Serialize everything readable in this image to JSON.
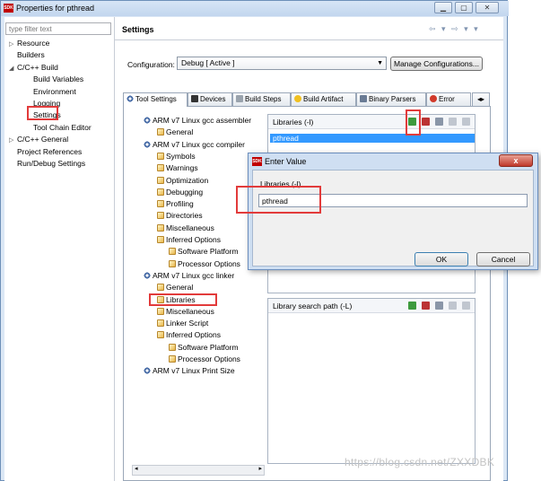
{
  "window": {
    "title": "Properties for pthread",
    "app_icon": "SDK",
    "controls": [
      "minimize-icon",
      "maximize-icon",
      "close-icon"
    ]
  },
  "filter": {
    "placeholder": "type filter text"
  },
  "nav_tree": [
    {
      "label": "Resource",
      "indent": 0,
      "toggle": "▷"
    },
    {
      "label": "Builders",
      "indent": 0,
      "toggle": ""
    },
    {
      "label": "C/C++ Build",
      "indent": 0,
      "toggle": "◢"
    },
    {
      "label": "Build Variables",
      "indent": 1,
      "toggle": ""
    },
    {
      "label": "Environment",
      "indent": 1,
      "toggle": ""
    },
    {
      "label": "Logging",
      "indent": 1,
      "toggle": ""
    },
    {
      "label": "Settings",
      "indent": 1,
      "toggle": ""
    },
    {
      "label": "Tool Chain Editor",
      "indent": 1,
      "toggle": ""
    },
    {
      "label": "C/C++ General",
      "indent": 0,
      "toggle": "▷"
    },
    {
      "label": "Project References",
      "indent": 0,
      "toggle": ""
    },
    {
      "label": "Run/Debug Settings",
      "indent": 0,
      "toggle": ""
    }
  ],
  "panel": {
    "title": "Settings",
    "nav_arrows": "⇦ ▾ ⇨ ▾ ▾",
    "config_label": "Configuration:",
    "config_value": "Debug  [ Active ]",
    "manage_button": "Manage Configurations..."
  },
  "tabs": [
    {
      "label": "Tool Settings",
      "icon": "gear-icon",
      "active": true
    },
    {
      "label": "Devices",
      "icon": "device-icon",
      "active": false
    },
    {
      "label": "Build Steps",
      "icon": "wrench-icon",
      "active": false
    },
    {
      "label": "Build Artifact",
      "icon": "artifact-icon",
      "active": false
    },
    {
      "label": "Binary Parsers",
      "icon": "binary-icon",
      "active": false
    },
    {
      "label": "Error",
      "icon": "error-icon",
      "active": false
    }
  ],
  "tool_tree": [
    {
      "label": "ARM v7 Linux gcc assembler",
      "indent": 0,
      "type": "gear"
    },
    {
      "label": "General",
      "indent": 1,
      "type": "page"
    },
    {
      "label": "ARM v7 Linux gcc compiler",
      "indent": 0,
      "type": "gear"
    },
    {
      "label": "Symbols",
      "indent": 1,
      "type": "page"
    },
    {
      "label": "Warnings",
      "indent": 1,
      "type": "page"
    },
    {
      "label": "Optimization",
      "indent": 1,
      "type": "page"
    },
    {
      "label": "Debugging",
      "indent": 1,
      "type": "page"
    },
    {
      "label": "Profiling",
      "indent": 1,
      "type": "page"
    },
    {
      "label": "Directories",
      "indent": 1,
      "type": "page"
    },
    {
      "label": "Miscellaneous",
      "indent": 1,
      "type": "page"
    },
    {
      "label": "Inferred Options",
      "indent": 1,
      "type": "page"
    },
    {
      "label": "Software Platform",
      "indent": 2,
      "type": "page"
    },
    {
      "label": "Processor Options",
      "indent": 2,
      "type": "page"
    },
    {
      "label": "ARM v7 Linux gcc linker",
      "indent": 0,
      "type": "gear"
    },
    {
      "label": "General",
      "indent": 1,
      "type": "page"
    },
    {
      "label": "Libraries",
      "indent": 1,
      "type": "page"
    },
    {
      "label": "Miscellaneous",
      "indent": 1,
      "type": "page"
    },
    {
      "label": "Linker Script",
      "indent": 1,
      "type": "page"
    },
    {
      "label": "Inferred Options",
      "indent": 1,
      "type": "page"
    },
    {
      "label": "Software Platform",
      "indent": 2,
      "type": "page"
    },
    {
      "label": "Processor Options",
      "indent": 2,
      "type": "page"
    },
    {
      "label": "ARM v7 Linux Print Size",
      "indent": 0,
      "type": "gear"
    }
  ],
  "libraries_box": {
    "label": "Libraries (-l)",
    "items": [
      "pthread"
    ]
  },
  "lib_search_box": {
    "label": "Library search path (-L)"
  },
  "dialog": {
    "title": "Enter Value",
    "close": "x",
    "field_label": "Libraries (-l)",
    "field_value": "pthread",
    "ok": "OK",
    "cancel": "Cancel"
  },
  "watermark": "https://blog.csdn.net/ZXXDBK",
  "colors": {
    "highlight_red": "#e23b3b",
    "selection_blue": "#3399ff"
  }
}
